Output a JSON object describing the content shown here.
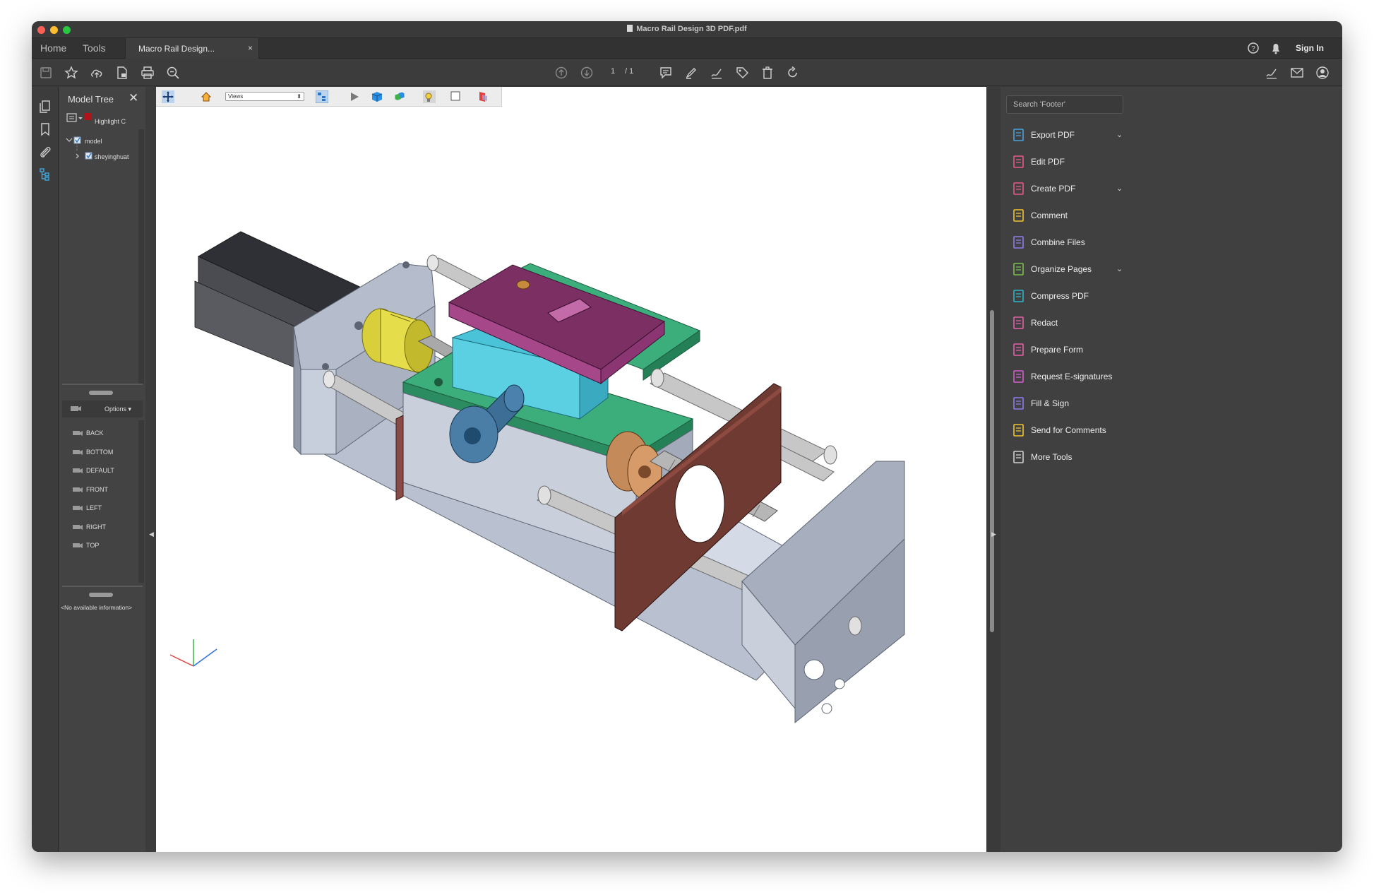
{
  "window": {
    "title": "Macro Rail Design 3D PDF.pdf",
    "traffic_colors": [
      "#fe5f57",
      "#febc2e",
      "#28c840"
    ]
  },
  "tabs": {
    "home": "Home",
    "tools": "Tools",
    "document": "Macro Rail Design...",
    "close": "×",
    "sign_in": "Sign In"
  },
  "toolbar": {
    "page_current": "1",
    "page_total": "/ 1"
  },
  "model_tree": {
    "title": "Model Tree",
    "close": "✕",
    "highlight": "Highlight C",
    "nodes": [
      "model",
      "sheyinghuat"
    ],
    "options_label": "Options ▾",
    "views": [
      "BACK",
      "BOTTOM",
      "DEFAULT",
      "FRONT",
      "LEFT",
      "RIGHT",
      "TOP"
    ],
    "info": "<No available information>"
  },
  "viewer": {
    "views_select": "Views"
  },
  "right_panel": {
    "search_placeholder": "Search 'Footer'",
    "tools": [
      {
        "label": "Export PDF",
        "icon": "export-pdf-icon",
        "color": "#4aa3df",
        "chevron": true
      },
      {
        "label": "Edit PDF",
        "icon": "edit-pdf-icon",
        "color": "#e8588a",
        "chevron": false
      },
      {
        "label": "Create PDF",
        "icon": "create-pdf-icon",
        "color": "#e8588a",
        "chevron": true
      },
      {
        "label": "Comment",
        "icon": "comment-icon",
        "color": "#f0c52d",
        "chevron": false
      },
      {
        "label": "Combine Files",
        "icon": "combine-files-icon",
        "color": "#8e7cf0",
        "chevron": false
      },
      {
        "label": "Organize Pages",
        "icon": "organize-pages-icon",
        "color": "#7cc04a",
        "chevron": true
      },
      {
        "label": "Compress PDF",
        "icon": "compress-pdf-icon",
        "color": "#2bb5c8",
        "chevron": false
      },
      {
        "label": "Redact",
        "icon": "redact-icon",
        "color": "#e860a8",
        "chevron": false
      },
      {
        "label": "Prepare Form",
        "icon": "prepare-form-icon",
        "color": "#e860a8",
        "chevron": false
      },
      {
        "label": "Request E-signatures",
        "icon": "request-esignatures-icon",
        "color": "#d45fd0",
        "chevron": false
      },
      {
        "label": "Fill & Sign",
        "icon": "fill-sign-icon",
        "color": "#8e7cf0",
        "chevron": false
      },
      {
        "label": "Send for Comments",
        "icon": "send-for-comments-icon",
        "color": "#f0c52d",
        "chevron": false
      },
      {
        "label": "More Tools",
        "icon": "more-tools-icon",
        "color": "#d0d0d0",
        "chevron": false
      }
    ]
  }
}
